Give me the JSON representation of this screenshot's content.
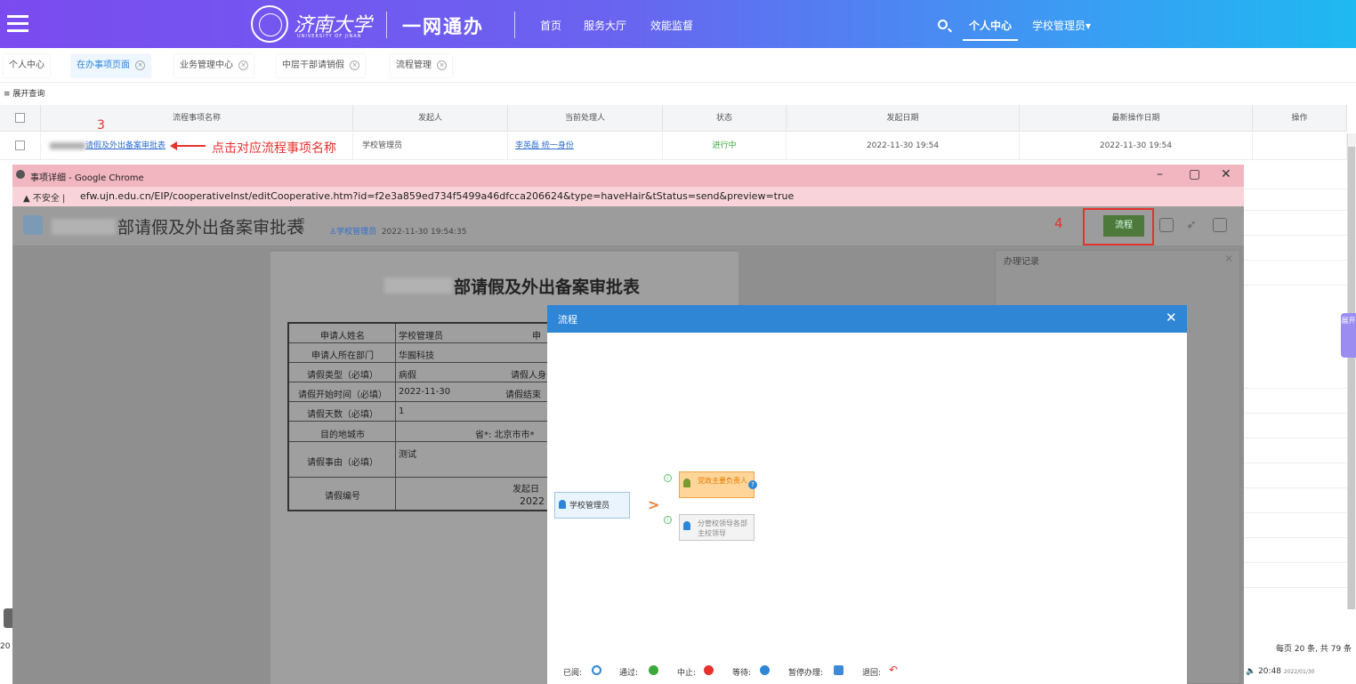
{
  "header": {
    "logo_text": "济南大学",
    "logo_sub": "UNIVERSITY OF JINAN",
    "portal_title": "一网通办",
    "nav": [
      "首页",
      "服务大厅",
      "效能监督"
    ],
    "personal_center": "个人中心",
    "user": "学校管理员▾"
  },
  "tabs": [
    {
      "label": "个人中心",
      "active": false,
      "closable": false
    },
    {
      "label": "在办事项页面",
      "active": true,
      "closable": true
    },
    {
      "label": "业务管理中心",
      "active": false,
      "closable": true
    },
    {
      "label": "中层干部请销假",
      "active": false,
      "closable": true
    },
    {
      "label": "流程管理",
      "active": false,
      "closable": true
    }
  ],
  "expand_query": "展开查询",
  "table": {
    "columns": [
      "流程事项名称",
      "发起人",
      "当前处理人",
      "状态",
      "发起日期",
      "最新操作日期",
      "操作"
    ],
    "rows": [
      {
        "name": "请假及外出备案审批表",
        "initiator": "学校管理员",
        "handler": "李英磊 统一身份",
        "status": "进行中",
        "start": "2022-11-30 19:54",
        "latest": "2022-11-30 19:54",
        "action": ""
      }
    ],
    "pagination": "每页 20 条, 共 79 条",
    "left_cut": "20"
  },
  "annotation": {
    "step3": "3",
    "text": "点击对应流程事项名称",
    "step4": "4"
  },
  "side_tab": "展开",
  "popup": {
    "window_title": "事项详细 - Google Chrome",
    "insecure": "不安全",
    "url": "efw.ujn.edu.cn/EIP/cooperativeInst/editCooperative.htm?id=f2e3a859ed734f5499a46dfcca206624&type=haveHair&tStatus=send&preview=true",
    "doc_title": "部请假及外出备案审批表",
    "doc_tag": "加急",
    "doc_user": "学校管理员",
    "doc_time": "2022-11-30 19:54:35",
    "flow_button": "流程",
    "record_title": "办理记录",
    "form_title": "部请假及外出备案审批表",
    "form_rows": [
      {
        "label": "申请人姓名",
        "value": "学校管理员",
        "extra": "申"
      },
      {
        "label": "申请人所在部门",
        "value": "华囿科技",
        "extra": ""
      },
      {
        "label": "请假类型（必填）",
        "value": "病假",
        "extra": "请假人身"
      },
      {
        "label": "请假开始时间（必填）",
        "value": "2022-11-30",
        "extra": "请假结束"
      },
      {
        "label": "请假天数（必填）",
        "value": "1",
        "extra": ""
      },
      {
        "label": "目的地城市",
        "value": "省*: 北京市市*",
        "extra": ""
      },
      {
        "label": "请假事由（必填）",
        "value": "测试",
        "extra": ""
      },
      {
        "label": "请假编号",
        "value": "发起日",
        "extra": "2022"
      }
    ]
  },
  "flow_dialog": {
    "title": "流程",
    "start_node": "学校管理员",
    "node_active": "党政主要负责人",
    "node_pending": "分管校领导各部主校领导",
    "legend": [
      "已阅:",
      "通过:",
      "中止:",
      "等待:",
      "暂停办理:",
      "退回:"
    ]
  },
  "taskbar": {
    "time": "20:48",
    "date": "2022/01/30"
  },
  "colors": {
    "header_start": "#7b4bef",
    "header_end": "#1fb9f1",
    "accent_blue": "#2f86d5",
    "annotation_red": "#e5322d",
    "status_green": "#3aa83a",
    "flow_button": "#4d7a3a"
  }
}
